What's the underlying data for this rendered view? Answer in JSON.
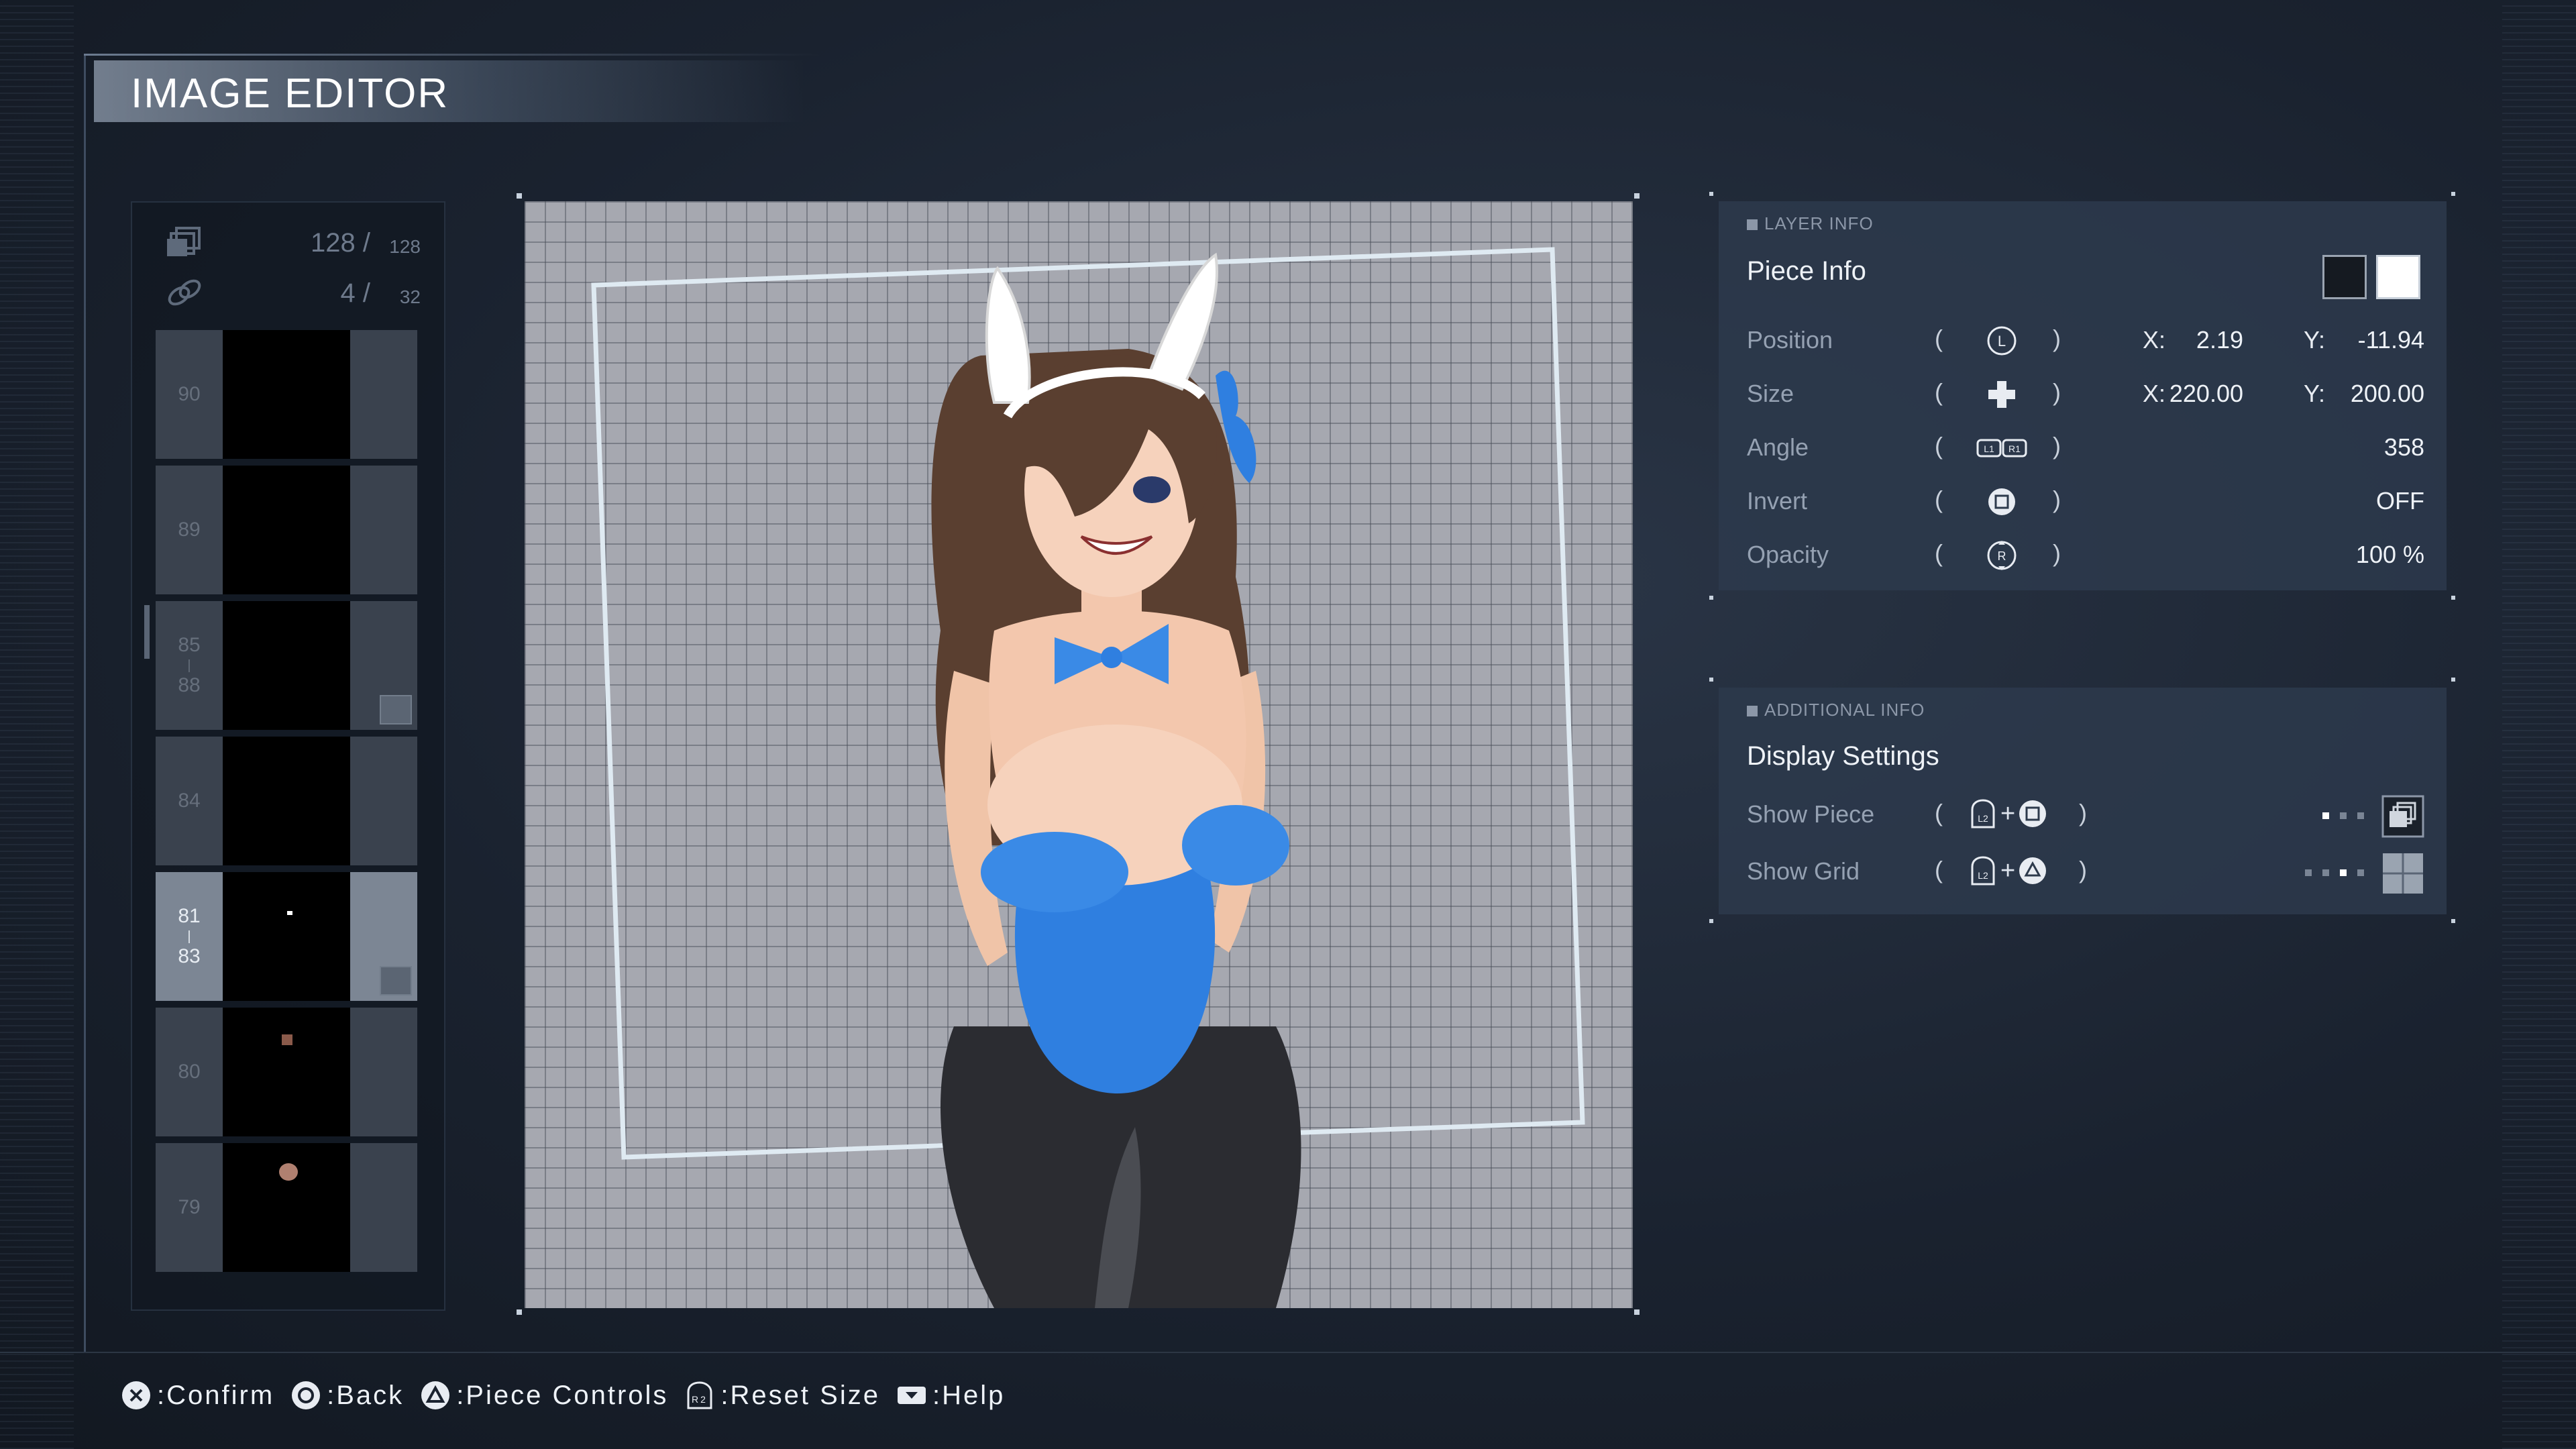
{
  "title": "IMAGE EDITOR",
  "layer_panel": {
    "piece_count": "128",
    "piece_max": "128",
    "group_count": "4",
    "group_max": "32",
    "layers": [
      {
        "num": "90",
        "num_end": "",
        "selected": false,
        "linked": false
      },
      {
        "num": "89",
        "num_end": "",
        "selected": false,
        "linked": false
      },
      {
        "num": "85",
        "num_end": "88",
        "selected": false,
        "linked": true
      },
      {
        "num": "84",
        "num_end": "",
        "selected": false,
        "linked": false
      },
      {
        "num": "81",
        "num_end": "83",
        "selected": true,
        "linked": true
      },
      {
        "num": "80",
        "num_end": "",
        "selected": false,
        "linked": false
      },
      {
        "num": "79",
        "num_end": "",
        "selected": false,
        "linked": false
      }
    ]
  },
  "layer_info": {
    "label": "LAYER INFO",
    "title": "Piece Info",
    "position": {
      "name": "Position",
      "x_label": "X:",
      "x": "2.19",
      "y_label": "Y:",
      "y": "-11.94",
      "icon": "l-stick-icon"
    },
    "size": {
      "name": "Size",
      "x_label": "X:",
      "x": "220.00",
      "y_label": "Y:",
      "y": "200.00",
      "icon": "dpad-icon"
    },
    "angle": {
      "name": "Angle",
      "value": "358",
      "icon": "l1-r1-icon"
    },
    "invert": {
      "name": "Invert",
      "value": "OFF",
      "icon": "square-button-icon"
    },
    "opacity": {
      "name": "Opacity",
      "value": "100 %",
      "icon": "r-stick-icon"
    },
    "paren_open": "(",
    "paren_close": ")"
  },
  "additional_info": {
    "label": "ADDITIONAL INFO",
    "title": "Display Settings",
    "show_piece": {
      "name": "Show Piece",
      "plus": "+",
      "icon": "l2-square-icon"
    },
    "show_grid": {
      "name": "Show Grid",
      "plus": "+",
      "icon": "l2-triangle-icon"
    }
  },
  "footer": {
    "confirm": ":Confirm",
    "back": ":Back",
    "piece_controls": ":Piece Controls",
    "reset_size": ":Reset Size",
    "help": ":Help"
  },
  "colors": {
    "accent": "#2f7fe0",
    "panel_bg": "#2d3a4c",
    "canvas_bg": "#a6a8b0",
    "selected_layer": "#7c8694"
  }
}
